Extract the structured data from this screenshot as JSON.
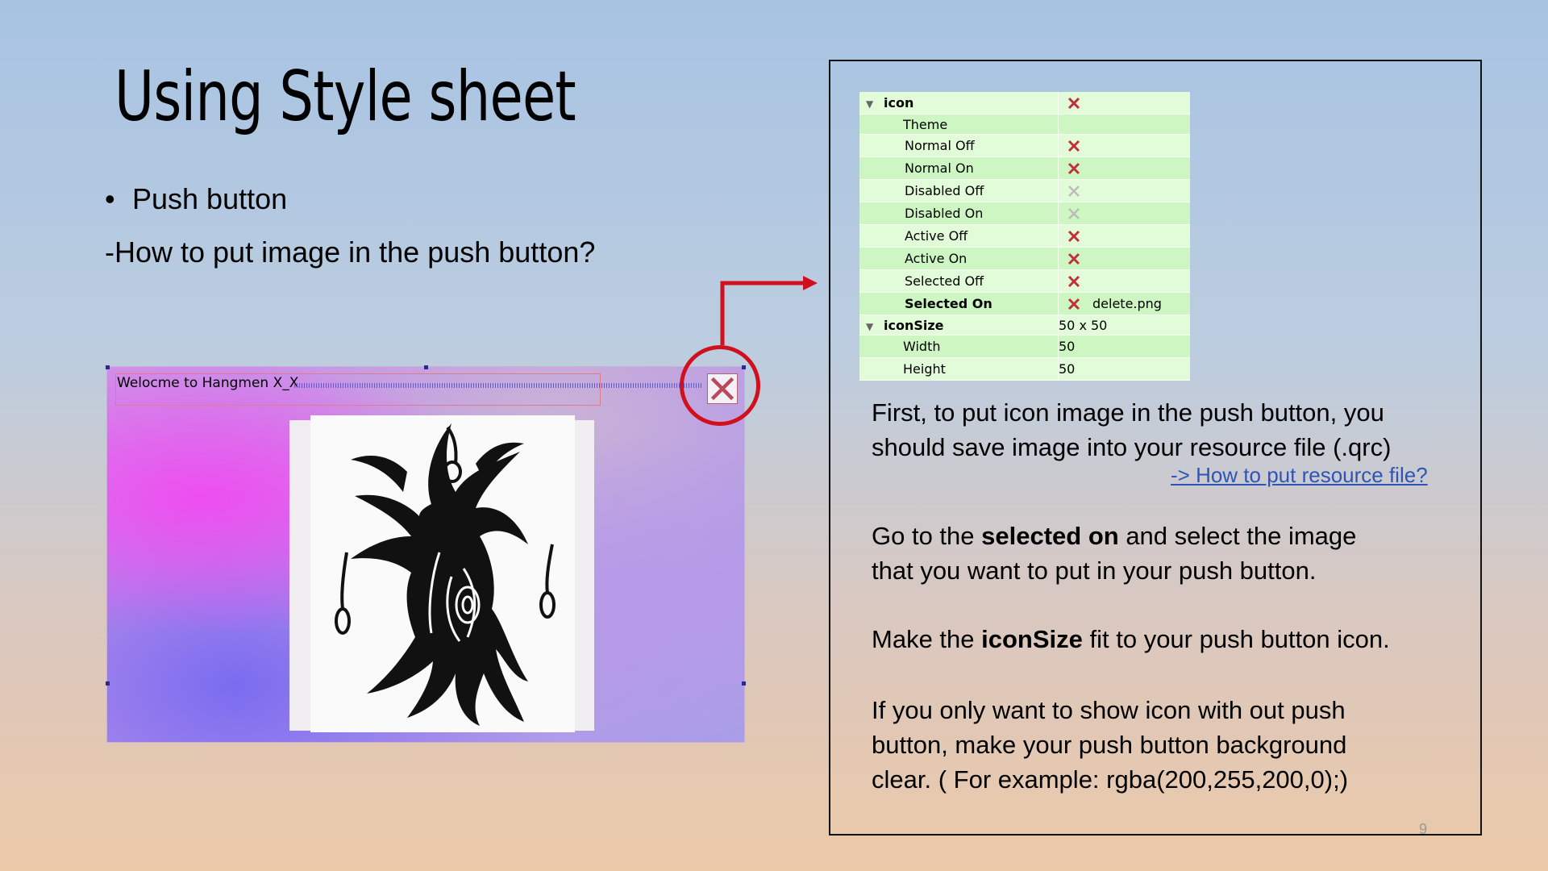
{
  "slide": {
    "title": "Using Style sheet",
    "bullet": "Push button",
    "question": "-How to put image in the push button?",
    "page_number": "9"
  },
  "qt_window": {
    "title_text": "Welocme  to Hangmen X_X"
  },
  "property_table": {
    "rows": [
      {
        "name": "icon",
        "value": "",
        "x_style": "red",
        "expanded": true,
        "bold": true,
        "shade": "light"
      },
      {
        "name": "Theme",
        "value": "",
        "x_style": "none",
        "shade": "dark"
      },
      {
        "name": "Normal Off",
        "value": "",
        "x_style": "red",
        "shade": "light"
      },
      {
        "name": "Normal On",
        "value": "",
        "x_style": "red",
        "shade": "dark"
      },
      {
        "name": "Disabled Off",
        "value": "",
        "x_style": "gray",
        "shade": "light"
      },
      {
        "name": "Disabled On",
        "value": "",
        "x_style": "gray",
        "shade": "dark"
      },
      {
        "name": "Active Off",
        "value": "",
        "x_style": "red",
        "shade": "light"
      },
      {
        "name": "Active On",
        "value": "",
        "x_style": "red",
        "shade": "dark"
      },
      {
        "name": "Selected Off",
        "value": "",
        "x_style": "red",
        "shade": "light"
      },
      {
        "name": "Selected On",
        "value": "delete.png",
        "x_style": "red",
        "bold": true,
        "shade": "dark"
      },
      {
        "name": "iconSize",
        "value": "50 x 50",
        "x_style": "none",
        "expanded": true,
        "bold": true,
        "shade": "light"
      },
      {
        "name": "Width",
        "value": "50",
        "x_style": "none",
        "shade": "dark"
      },
      {
        "name": "Height",
        "value": "50",
        "x_style": "none",
        "shade": "light"
      }
    ]
  },
  "instructions": {
    "p1_line1": "First, to put icon image in the push button, you",
    "p1_line2": "should save image into your resource file (.qrc)",
    "link": "-> How to put resource file?",
    "p2_pre": "Go to the ",
    "p2_bold": "selected on",
    "p2_post": " and select the image",
    "p2_line2": "that you want to put in your push button.",
    "p3_pre": "Make the ",
    "p3_bold": "iconSize",
    "p3_post": " fit to your push button icon.",
    "p4_line1": "If you only want to show icon with out push",
    "p4_line2": "button, make your push button background",
    "p4_line3": "clear. ( For example: rgba(200,255,200,0);)"
  },
  "colors": {
    "highlight_red": "#d0101c",
    "link_blue": "#2d55b8",
    "table_light": "#e2fbd9",
    "table_dark": "#cef6c2"
  }
}
